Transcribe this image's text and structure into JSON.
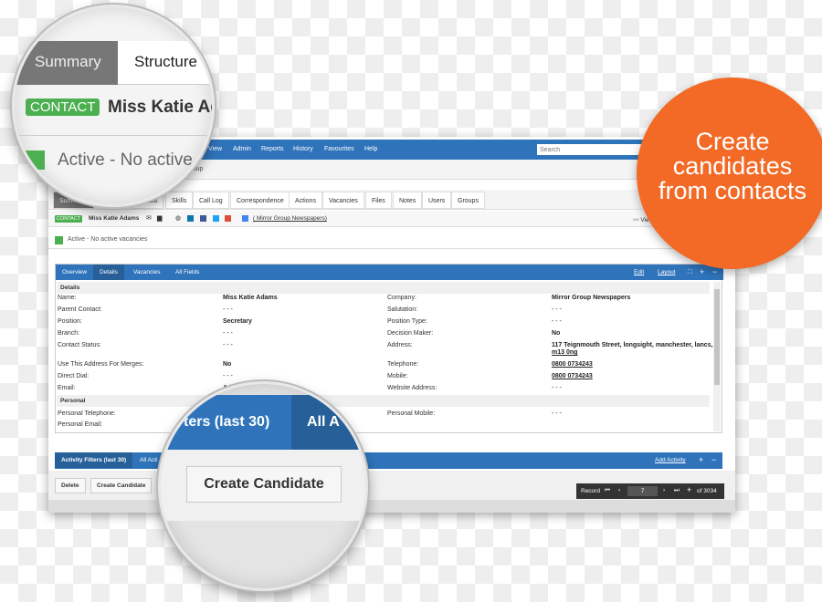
{
  "nav": {
    "items": [
      "View",
      "Admin",
      "Reports",
      "History",
      "Favourites",
      "Help"
    ],
    "search_placeholder": "Search"
  },
  "breadcrumb": "Group",
  "tabs": [
    "Summary",
    "Details",
    "Skills",
    "Call Log",
    "Correspondence",
    "Actions",
    "Vacancies",
    "Files",
    "Notes",
    "Users",
    "Groups"
  ],
  "contact": {
    "badge": "CONTACT",
    "name": "Miss Katie Adams",
    "company_link": "( Mirror Group Newspapers)",
    "view_label": "Vie"
  },
  "status": "Active - No active vacancies",
  "panel": {
    "tabs": [
      "Overview",
      "Details",
      "Vacancies",
      "All Fields"
    ],
    "edit": "Edit",
    "layout": "Layout",
    "sections": {
      "details": "Details",
      "personal": "Personal"
    },
    "left": [
      [
        "Name:",
        "Miss Katie Adams"
      ],
      [
        "Parent Contact:",
        "- - -"
      ],
      [
        "Position:",
        "Secretary"
      ],
      [
        "Branch:",
        "- - -"
      ],
      [
        "Contact Status:",
        "- - -"
      ],
      [
        "Use This Address For Merges:",
        "No"
      ],
      [
        "Direct Dial:",
        "- - -"
      ],
      [
        "Email:",
        "Adam…systems.co.uk"
      ]
    ],
    "right": [
      [
        "Company:",
        "Mirror Group Newspapers"
      ],
      [
        "Salutation:",
        "- - -"
      ],
      [
        "Position Type:",
        "- - -"
      ],
      [
        "Decision Maker:",
        "No"
      ],
      [
        "Address:",
        "117 Teignmouth Street, longsight, manchester, lancs,",
        "m13 0ng"
      ],
      [
        "Telephone:",
        "0800 0734243"
      ],
      [
        "Mobile:",
        "0800 0734243"
      ],
      [
        "Website Address:",
        "- - -"
      ]
    ],
    "personal_left": [
      "Personal Telephone:",
      "Personal Email:"
    ],
    "personal_right": [
      [
        "Personal Mobile:",
        "- - -"
      ]
    ]
  },
  "activity": {
    "tab1": "Activity Filters (last 30)",
    "tab2": "All Acti",
    "add": "Add Activity"
  },
  "buttons": {
    "delete": "Delete",
    "create": "Create Candidate"
  },
  "record": {
    "label": "Record",
    "value": "7",
    "of": "of 3034"
  },
  "magnifier_top": {
    "tab1": "Summary",
    "tab2": "Structure",
    "badge": "CONTACT",
    "name": "Miss Katie Ad",
    "status": "Active - No active"
  },
  "magnifier_bottom": {
    "tab1": "ters (last 30)",
    "tab2": "All A",
    "button": "Create Candidate"
  },
  "callout": {
    "line1": "Create",
    "line2": "candidates",
    "line3": "from contacts",
    "color": "#f26a26"
  },
  "colors": {
    "brand_blue": "#2f74bb",
    "active_green": "#4caf50"
  }
}
